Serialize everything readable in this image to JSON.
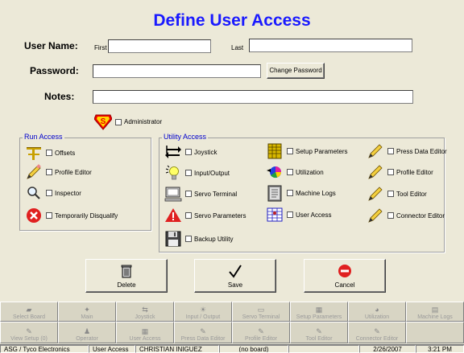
{
  "title": "Define User Access",
  "user": {
    "name_label": "User Name:",
    "first_label": "First",
    "first_value": "",
    "last_label": "Last",
    "last_value": "",
    "password_label": "Password:",
    "password_value": "",
    "change_password_label": "Change Password",
    "notes_label": "Notes:",
    "notes_value": "",
    "administrator_label": "Administrator"
  },
  "run_access": {
    "title": "Run Access",
    "items": [
      {
        "label": "Offsets",
        "icon": "offsets-icon"
      },
      {
        "label": "Profile Editor",
        "icon": "pencil-icon"
      },
      {
        "label": "Inspector",
        "icon": "magnifier-icon"
      },
      {
        "label": "Temporarily Disqualify",
        "icon": "red-x-icon"
      }
    ]
  },
  "utility_access": {
    "title": "Utility Access",
    "col1": [
      {
        "label": "Joystick",
        "icon": "arrows-icon"
      },
      {
        "label": "Input/Output",
        "icon": "lightbulb-icon"
      },
      {
        "label": "Servo Terminal",
        "icon": "computer-icon"
      },
      {
        "label": "Servo Parameters",
        "icon": "warning-icon"
      },
      {
        "label": "Backup Utility",
        "icon": "floppy-icon"
      }
    ],
    "col2": [
      {
        "label": "Setup Parameters",
        "icon": "grid-icon"
      },
      {
        "label": "Utilization",
        "icon": "pie-chart-icon"
      },
      {
        "label": "Machine Logs",
        "icon": "logs-icon"
      },
      {
        "label": "User Access",
        "icon": "user-access-icon"
      }
    ],
    "col3": [
      {
        "label": "Press Data Editor",
        "icon": "pencil-icon"
      },
      {
        "label": "Profile Editor",
        "icon": "pencil-icon"
      },
      {
        "label": "Tool Editor",
        "icon": "pencil-icon"
      },
      {
        "label": "Connector Editor",
        "icon": "pencil-icon"
      }
    ]
  },
  "actions": {
    "delete": "Delete",
    "save": "Save",
    "cancel": "Cancel"
  },
  "nav_row1": [
    "Select Board",
    "Main",
    "Joystick",
    "Input / Output",
    "Servo Terminal",
    "Setup Parameters",
    "Utilization",
    "Machine Logs"
  ],
  "nav_row2": [
    "View Setup (0)",
    "Operator",
    "User Access",
    "Press Data Editor",
    "Profile Editor",
    "Tool Editor",
    "Connector Editor"
  ],
  "status": {
    "company": "ASG / Tyco Electronics",
    "screen": "User Access",
    "user": "CHRISTIAN INIGUEZ",
    "board": "(no board)",
    "blank": "",
    "date": "2/26/2007",
    "time": "3:21 PM"
  },
  "colors": {
    "title": "#1a1aff",
    "group_title": "#0000cc",
    "background": "#ece9d8"
  }
}
